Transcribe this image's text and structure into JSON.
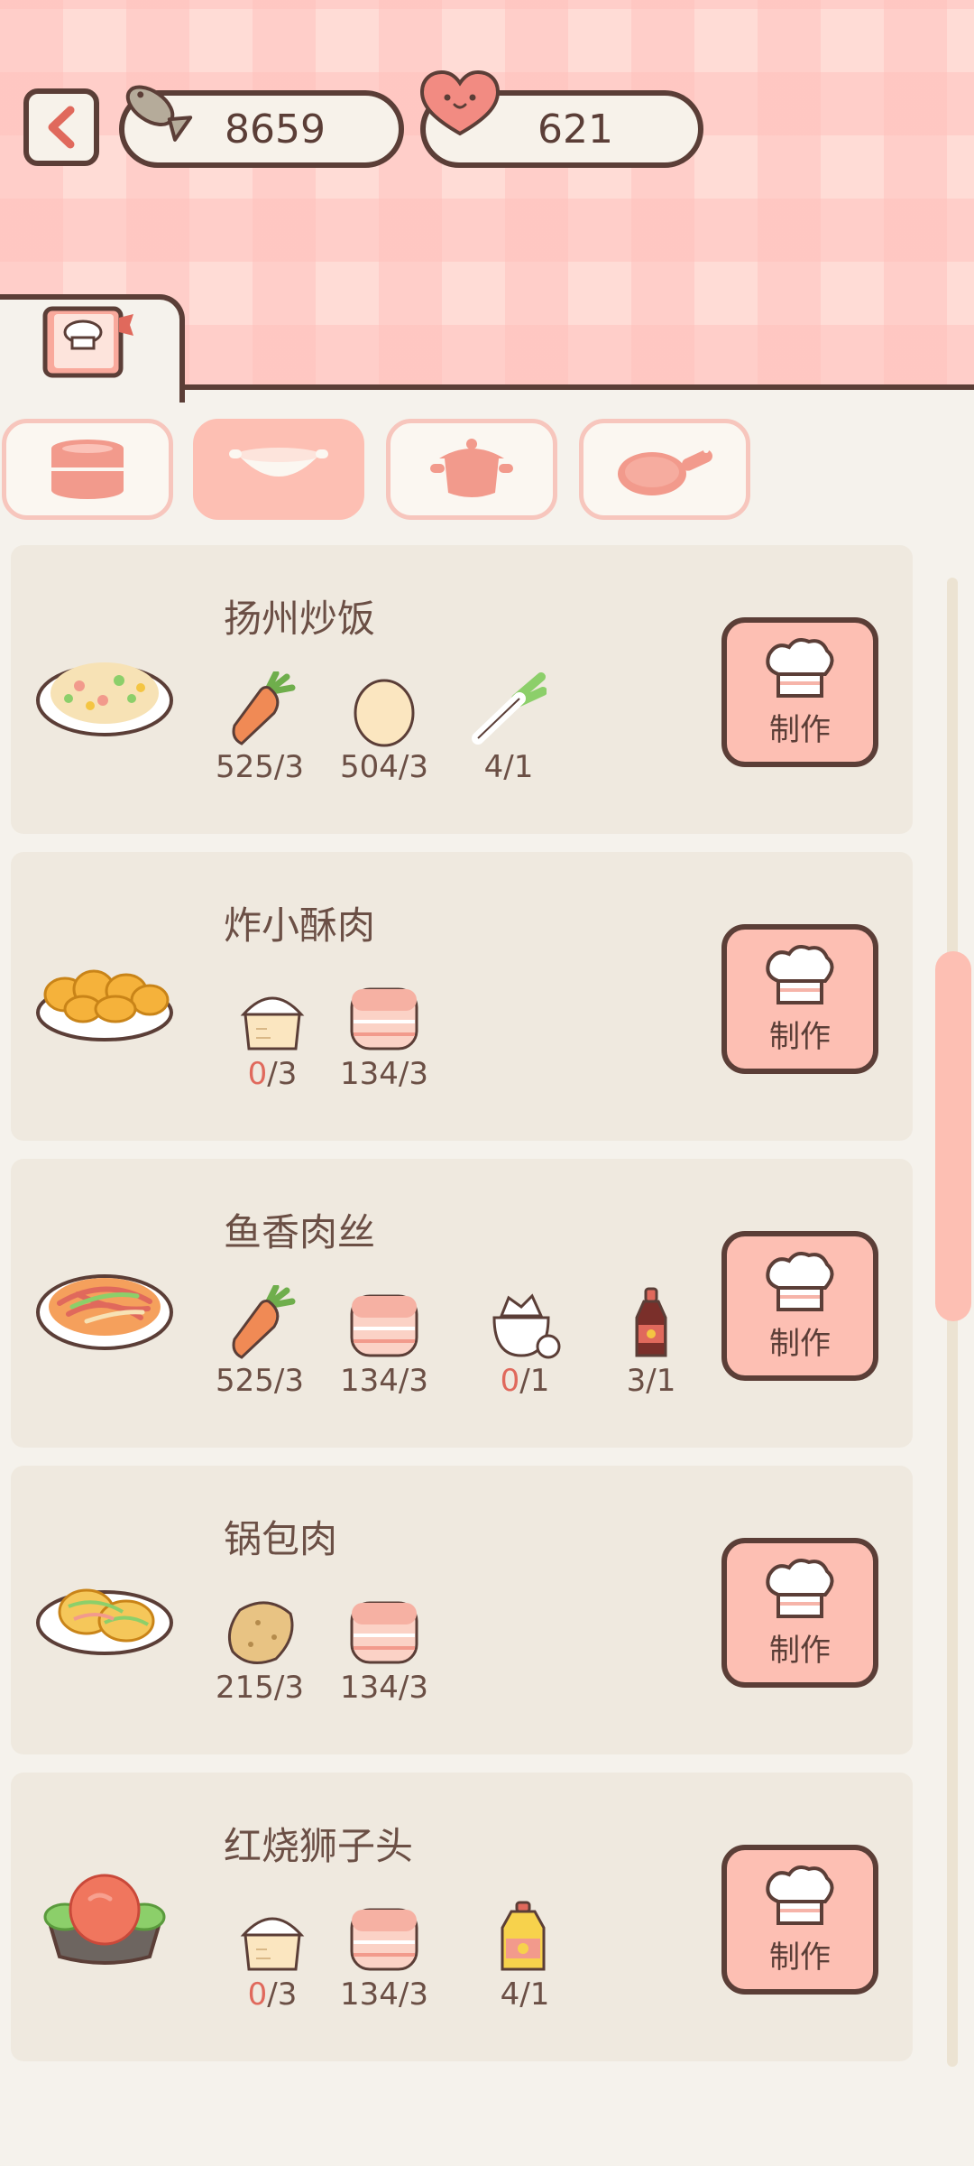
{
  "header": {
    "fish_count": "8659",
    "heart_count": "621"
  },
  "categories": [
    {
      "name": "steamer",
      "active": false
    },
    {
      "name": "wok",
      "active": true
    },
    {
      "name": "pot",
      "active": false
    },
    {
      "name": "pan",
      "active": false
    }
  ],
  "make_label": "制作",
  "dishes": [
    {
      "name": "扬州炒饭",
      "ingredients": [
        {
          "icon": "carrot-icon",
          "have": "525",
          "need": "/3",
          "lacking": false
        },
        {
          "icon": "egg-icon",
          "have": "504",
          "need": "/3",
          "lacking": false
        },
        {
          "icon": "scallion-icon",
          "have": "4",
          "need": "/1",
          "lacking": false
        }
      ]
    },
    {
      "name": "炸小酥肉",
      "ingredients": [
        {
          "icon": "flour-icon",
          "have": "0",
          "need": "/3",
          "lacking": true
        },
        {
          "icon": "pork-icon",
          "have": "134",
          "need": "/3",
          "lacking": false
        }
      ]
    },
    {
      "name": "鱼香肉丝",
      "ingredients": [
        {
          "icon": "carrot-icon",
          "have": "525",
          "need": "/3",
          "lacking": false
        },
        {
          "icon": "pork-icon",
          "have": "134",
          "need": "/3",
          "lacking": false
        },
        {
          "icon": "sugar-icon",
          "have": "0",
          "need": "/1",
          "lacking": true
        },
        {
          "icon": "soy-sauce-icon",
          "have": "3",
          "need": "/1",
          "lacking": false
        }
      ]
    },
    {
      "name": "锅包肉",
      "ingredients": [
        {
          "icon": "potato-icon",
          "have": "215",
          "need": "/3",
          "lacking": false
        },
        {
          "icon": "pork-icon",
          "have": "134",
          "need": "/3",
          "lacking": false
        }
      ]
    },
    {
      "name": "红烧狮子头",
      "ingredients": [
        {
          "icon": "flour-icon",
          "have": "0",
          "need": "/3",
          "lacking": true
        },
        {
          "icon": "pork-icon",
          "have": "134",
          "need": "/3",
          "lacking": false
        },
        {
          "icon": "oil-icon",
          "have": "4",
          "need": "/1",
          "lacking": false
        }
      ]
    }
  ]
}
